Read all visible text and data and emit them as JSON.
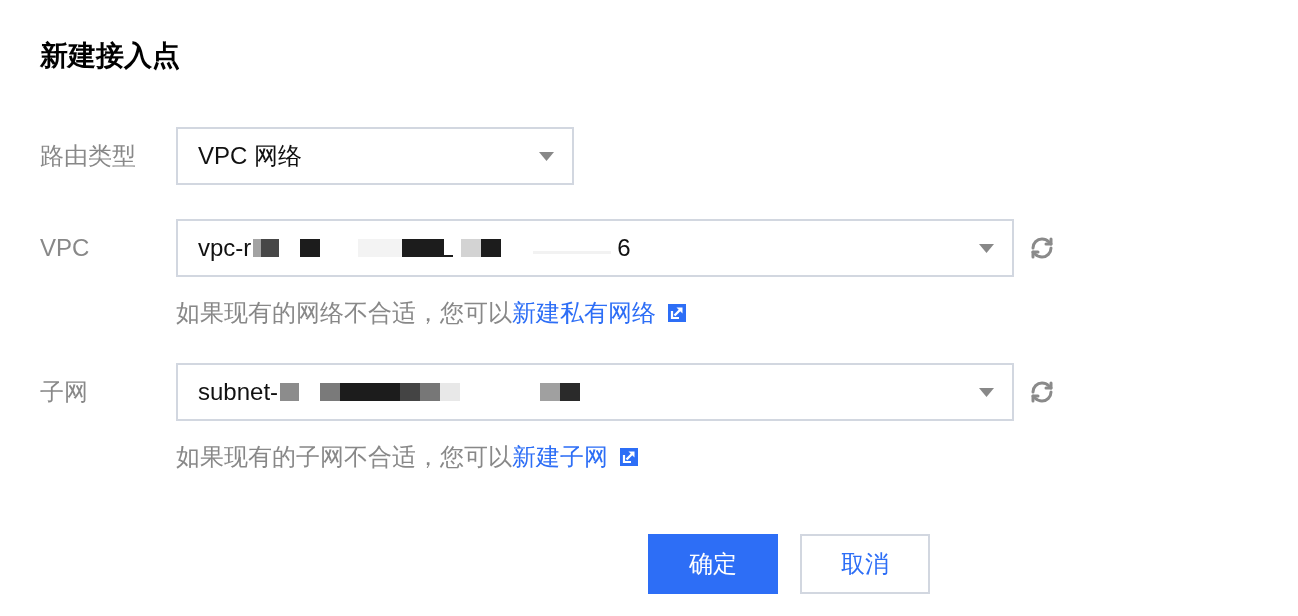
{
  "dialog": {
    "title": "新建接入点"
  },
  "fields": [
    {
      "label": "路由类型",
      "value": "VPC 网络",
      "redacted": false,
      "refresh": false
    },
    {
      "label": "VPC",
      "value": "vpc-r",
      "redacted": true,
      "value_tail": "6",
      "refresh": true,
      "hint": "如果现有的网络不合适，您可以",
      "hint_link": "新建私有网络"
    },
    {
      "label": "子网",
      "value": "subnet-",
      "redacted": true,
      "refresh": true,
      "hint": "如果现有的子网不合适，您可以",
      "hint_link": "新建子网"
    }
  ],
  "buttons": [
    {
      "label": "确定",
      "primary": true
    },
    {
      "label": "取消",
      "primary": false
    }
  ]
}
